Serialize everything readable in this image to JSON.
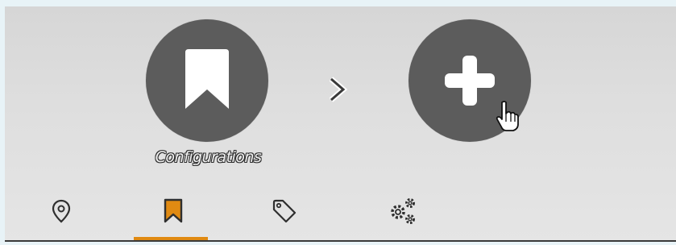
{
  "actions": {
    "configurations_label": "Configurations",
    "add_icon": "plus-icon",
    "config_icon": "bookmark-icon",
    "next_icon": "chevron-right-icon"
  },
  "tabs": [
    {
      "icon": "location-pin-icon",
      "active": false
    },
    {
      "icon": "bookmark-icon",
      "active": true
    },
    {
      "icon": "tag-icon",
      "active": false
    },
    {
      "icon": "gears-icon",
      "active": false
    }
  ],
  "colors": {
    "circle": "#5c5c5c",
    "accent": "#e08a12",
    "panel": "#dedede",
    "icon": "#ffffff",
    "tab_icon": "#2f2f2f"
  }
}
